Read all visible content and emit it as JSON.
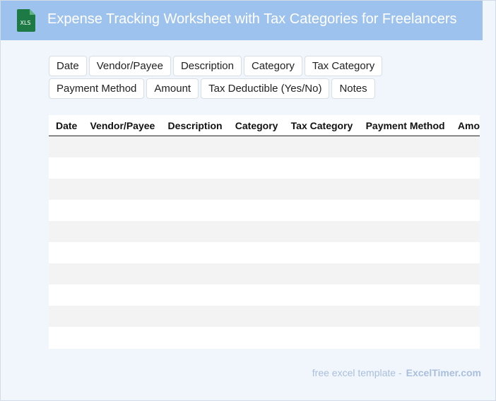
{
  "header": {
    "title": "Expense Tracking Worksheet with Tax Categories for Freelancers",
    "icon_label": "XLS"
  },
  "chips": [
    "Date",
    "Vendor/Payee",
    "Description",
    "Category",
    "Tax Category",
    "Payment Method",
    "Amount",
    "Tax Deductible (Yes/No)",
    "Notes"
  ],
  "table": {
    "columns": [
      "Date",
      "Vendor/Payee",
      "Description",
      "Category",
      "Tax Category",
      "Payment Method",
      "Amount"
    ],
    "row_count": 10
  },
  "footer": {
    "template_text": "free excel template -",
    "brand": "ExcelTimer.com"
  },
  "colors": {
    "header_bg": "#9ec2ee",
    "page_bg": "#f1f6fd",
    "icon_green": "#1d7a45",
    "footer_text": "#a9bfdc"
  }
}
